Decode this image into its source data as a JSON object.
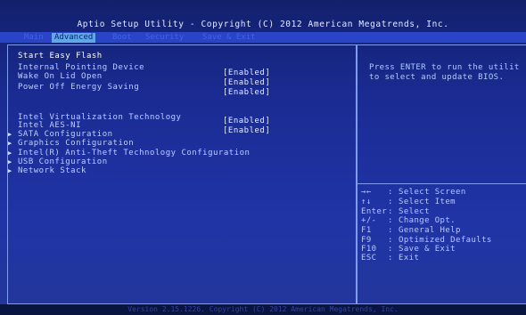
{
  "header": {
    "title": "Aptio Setup Utility - Copyright (C) 2012 American Megatrends, Inc."
  },
  "tabs": [
    {
      "label": "Main"
    },
    {
      "label": "Advanced"
    },
    {
      "label": "Boot"
    },
    {
      "label": "Security"
    },
    {
      "label": "Save & Exit"
    }
  ],
  "settings": {
    "start_easy_flash": "Start Easy Flash",
    "internal_pointing_device": {
      "label": "Internal Pointing Device",
      "value": "[Enabled]"
    },
    "wake_on_lid_open": {
      "label": "Wake On Lid Open",
      "value": "[Enabled]"
    },
    "power_off_energy_saving": {
      "label": "Power Off Energy Saving",
      "value": "[Enabled]"
    },
    "intel_virtualization": {
      "label": "Intel Virtualization Technology",
      "value": "[Enabled]"
    },
    "intel_aes_ni": {
      "label": "Intel AES-NI",
      "value": "[Enabled]"
    }
  },
  "submenus": [
    {
      "label": "SATA Configuration"
    },
    {
      "label": "Graphics Configuration"
    },
    {
      "label": "Intel(R) Anti-Theft Technology Configuration"
    },
    {
      "label": "USB Configuration"
    },
    {
      "label": "Network Stack"
    }
  ],
  "help": {
    "line1": "Press ENTER to run the utilit",
    "line2": "to select and update BIOS."
  },
  "legend": [
    {
      "key": "→←",
      "action": "Select Screen"
    },
    {
      "key": "↑↓",
      "action": "Select Item"
    },
    {
      "key": "Enter",
      "action": "Select"
    },
    {
      "key": "+/-",
      "action": "Change Opt."
    },
    {
      "key": "F1",
      "action": "General Help"
    },
    {
      "key": "F9",
      "action": "Optimized Defaults"
    },
    {
      "key": "F10",
      "action": "Save & Exit"
    },
    {
      "key": "ESC",
      "action": "Exit"
    }
  ],
  "footer": {
    "version": "Version 2.15.1226. Copyright (C) 2012 American Megatrends, Inc."
  },
  "colors": {
    "background": "#1a2b92",
    "active_tab": "#5fa7e6",
    "text": "#bfcfff",
    "value_text": "#e7edff"
  }
}
